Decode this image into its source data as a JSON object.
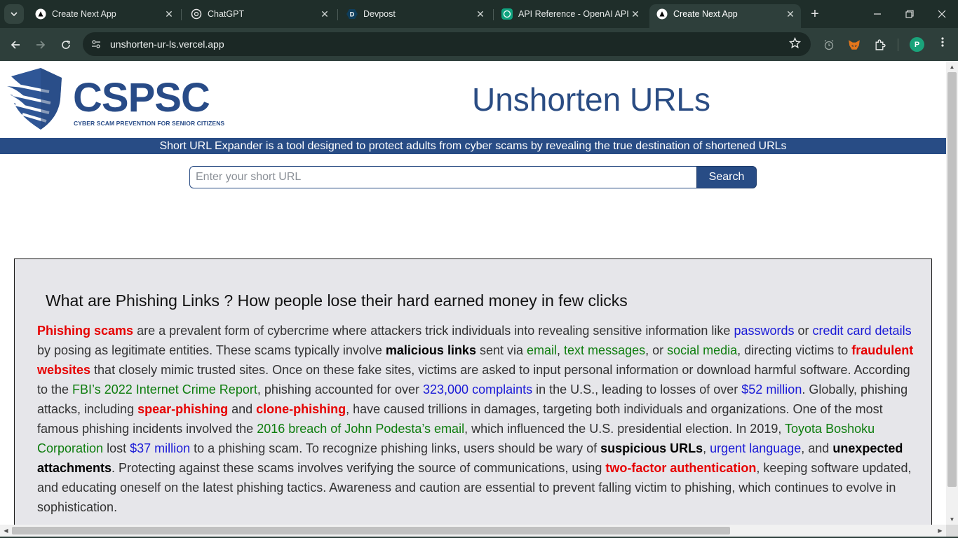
{
  "browser": {
    "tabs": [
      {
        "title": "Create Next App",
        "icon": "nextjs-icon",
        "active": false
      },
      {
        "title": "ChatGPT",
        "icon": "openai-icon",
        "active": false
      },
      {
        "title": "Devpost",
        "icon": "devpost-icon",
        "active": false
      },
      {
        "title": "API Reference - OpenAI API",
        "icon": "openai-icon",
        "active": false
      },
      {
        "title": "Create Next App",
        "icon": "nextjs-icon",
        "active": true
      }
    ],
    "url": "unshorten-ur-ls.vercel.app",
    "profile_initial": "P",
    "tab_close_glyph": "✕",
    "new_tab_glyph": "+",
    "colors": {
      "frame": "#1f2e2a",
      "toolbar": "#2e3f3b",
      "active_tab": "#2e3f3b"
    }
  },
  "page": {
    "logo": {
      "name": "CSPSC",
      "tagline": "CYBER SCAM PREVENTION FOR SENIOR CITIZENS"
    },
    "title": "Unshorten URLs",
    "banner": "Short URL Expander is a tool designed to protect adults from cyber scams by revealing the true destination of shortened URLs",
    "search": {
      "placeholder": "Enter your short URL",
      "value": "",
      "button_label": "Search"
    },
    "info": {
      "heading": "What are Phishing Links ? How people lose their hard earned money in few clicks",
      "segments": [
        {
          "t": "Phishing scams",
          "s": "r"
        },
        {
          "t": " are a prevalent form of cybercrime where attackers trick individuals into revealing sensitive information like ",
          "s": ""
        },
        {
          "t": "passwords",
          "s": "b"
        },
        {
          "t": " or ",
          "s": ""
        },
        {
          "t": "credit card details",
          "s": "b"
        },
        {
          "t": " by posing as legitimate entities. These scams typically involve ",
          "s": ""
        },
        {
          "t": "malicious links",
          "s": "k"
        },
        {
          "t": " sent via ",
          "s": ""
        },
        {
          "t": "email",
          "s": "g"
        },
        {
          "t": ", ",
          "s": ""
        },
        {
          "t": "text messages",
          "s": "g"
        },
        {
          "t": ", or ",
          "s": ""
        },
        {
          "t": "social media",
          "s": "g"
        },
        {
          "t": ", directing victims to ",
          "s": ""
        },
        {
          "t": "fraudulent websites",
          "s": "r"
        },
        {
          "t": " that closely mimic trusted sites. Once on these fake sites, victims are asked to input personal information or download harmful software. According to the ",
          "s": ""
        },
        {
          "t": "FBI’s 2022 Internet Crime Report",
          "s": "g"
        },
        {
          "t": ", phishing accounted for over ",
          "s": ""
        },
        {
          "t": "323,000 complaints",
          "s": "b"
        },
        {
          "t": " in the U.S., leading to losses of over ",
          "s": ""
        },
        {
          "t": "$52 million",
          "s": "b"
        },
        {
          "t": ". Globally, phishing attacks, including ",
          "s": ""
        },
        {
          "t": "spear-phishing",
          "s": "r"
        },
        {
          "t": " and ",
          "s": ""
        },
        {
          "t": "clone-phishing",
          "s": "r"
        },
        {
          "t": ", have caused trillions in damages, targeting both individuals and organizations. One of the most famous phishing incidents involved the ",
          "s": ""
        },
        {
          "t": "2016 breach of John Podesta’s email",
          "s": "g"
        },
        {
          "t": ", which influenced the U.S. presidential election. In 2019, ",
          "s": ""
        },
        {
          "t": "Toyota Boshoku Corporation",
          "s": "g"
        },
        {
          "t": " lost ",
          "s": ""
        },
        {
          "t": "$37 million",
          "s": "b"
        },
        {
          "t": " to a phishing scam. To recognize phishing links, users should be wary of ",
          "s": ""
        },
        {
          "t": "suspicious URLs",
          "s": "k"
        },
        {
          "t": ", ",
          "s": ""
        },
        {
          "t": "urgent language",
          "s": "b"
        },
        {
          "t": ", and ",
          "s": ""
        },
        {
          "t": "unexpected attachments",
          "s": "k"
        },
        {
          "t": ". Protecting against these scams involves verifying the source of communications, using ",
          "s": ""
        },
        {
          "t": "two-factor authentication",
          "s": "r"
        },
        {
          "t": ", keeping software updated, and educating oneself on the latest phishing tactics. Awareness and caution are essential to prevent falling victim to phishing, which continues to evolve in sophistication.",
          "s": ""
        }
      ]
    },
    "colors": {
      "brand": "#284c85",
      "highlight_red": "#e60000",
      "highlight_blue": "#1a1ad6",
      "highlight_green": "#0e7d0e",
      "panel": "#e6e6ea"
    }
  }
}
